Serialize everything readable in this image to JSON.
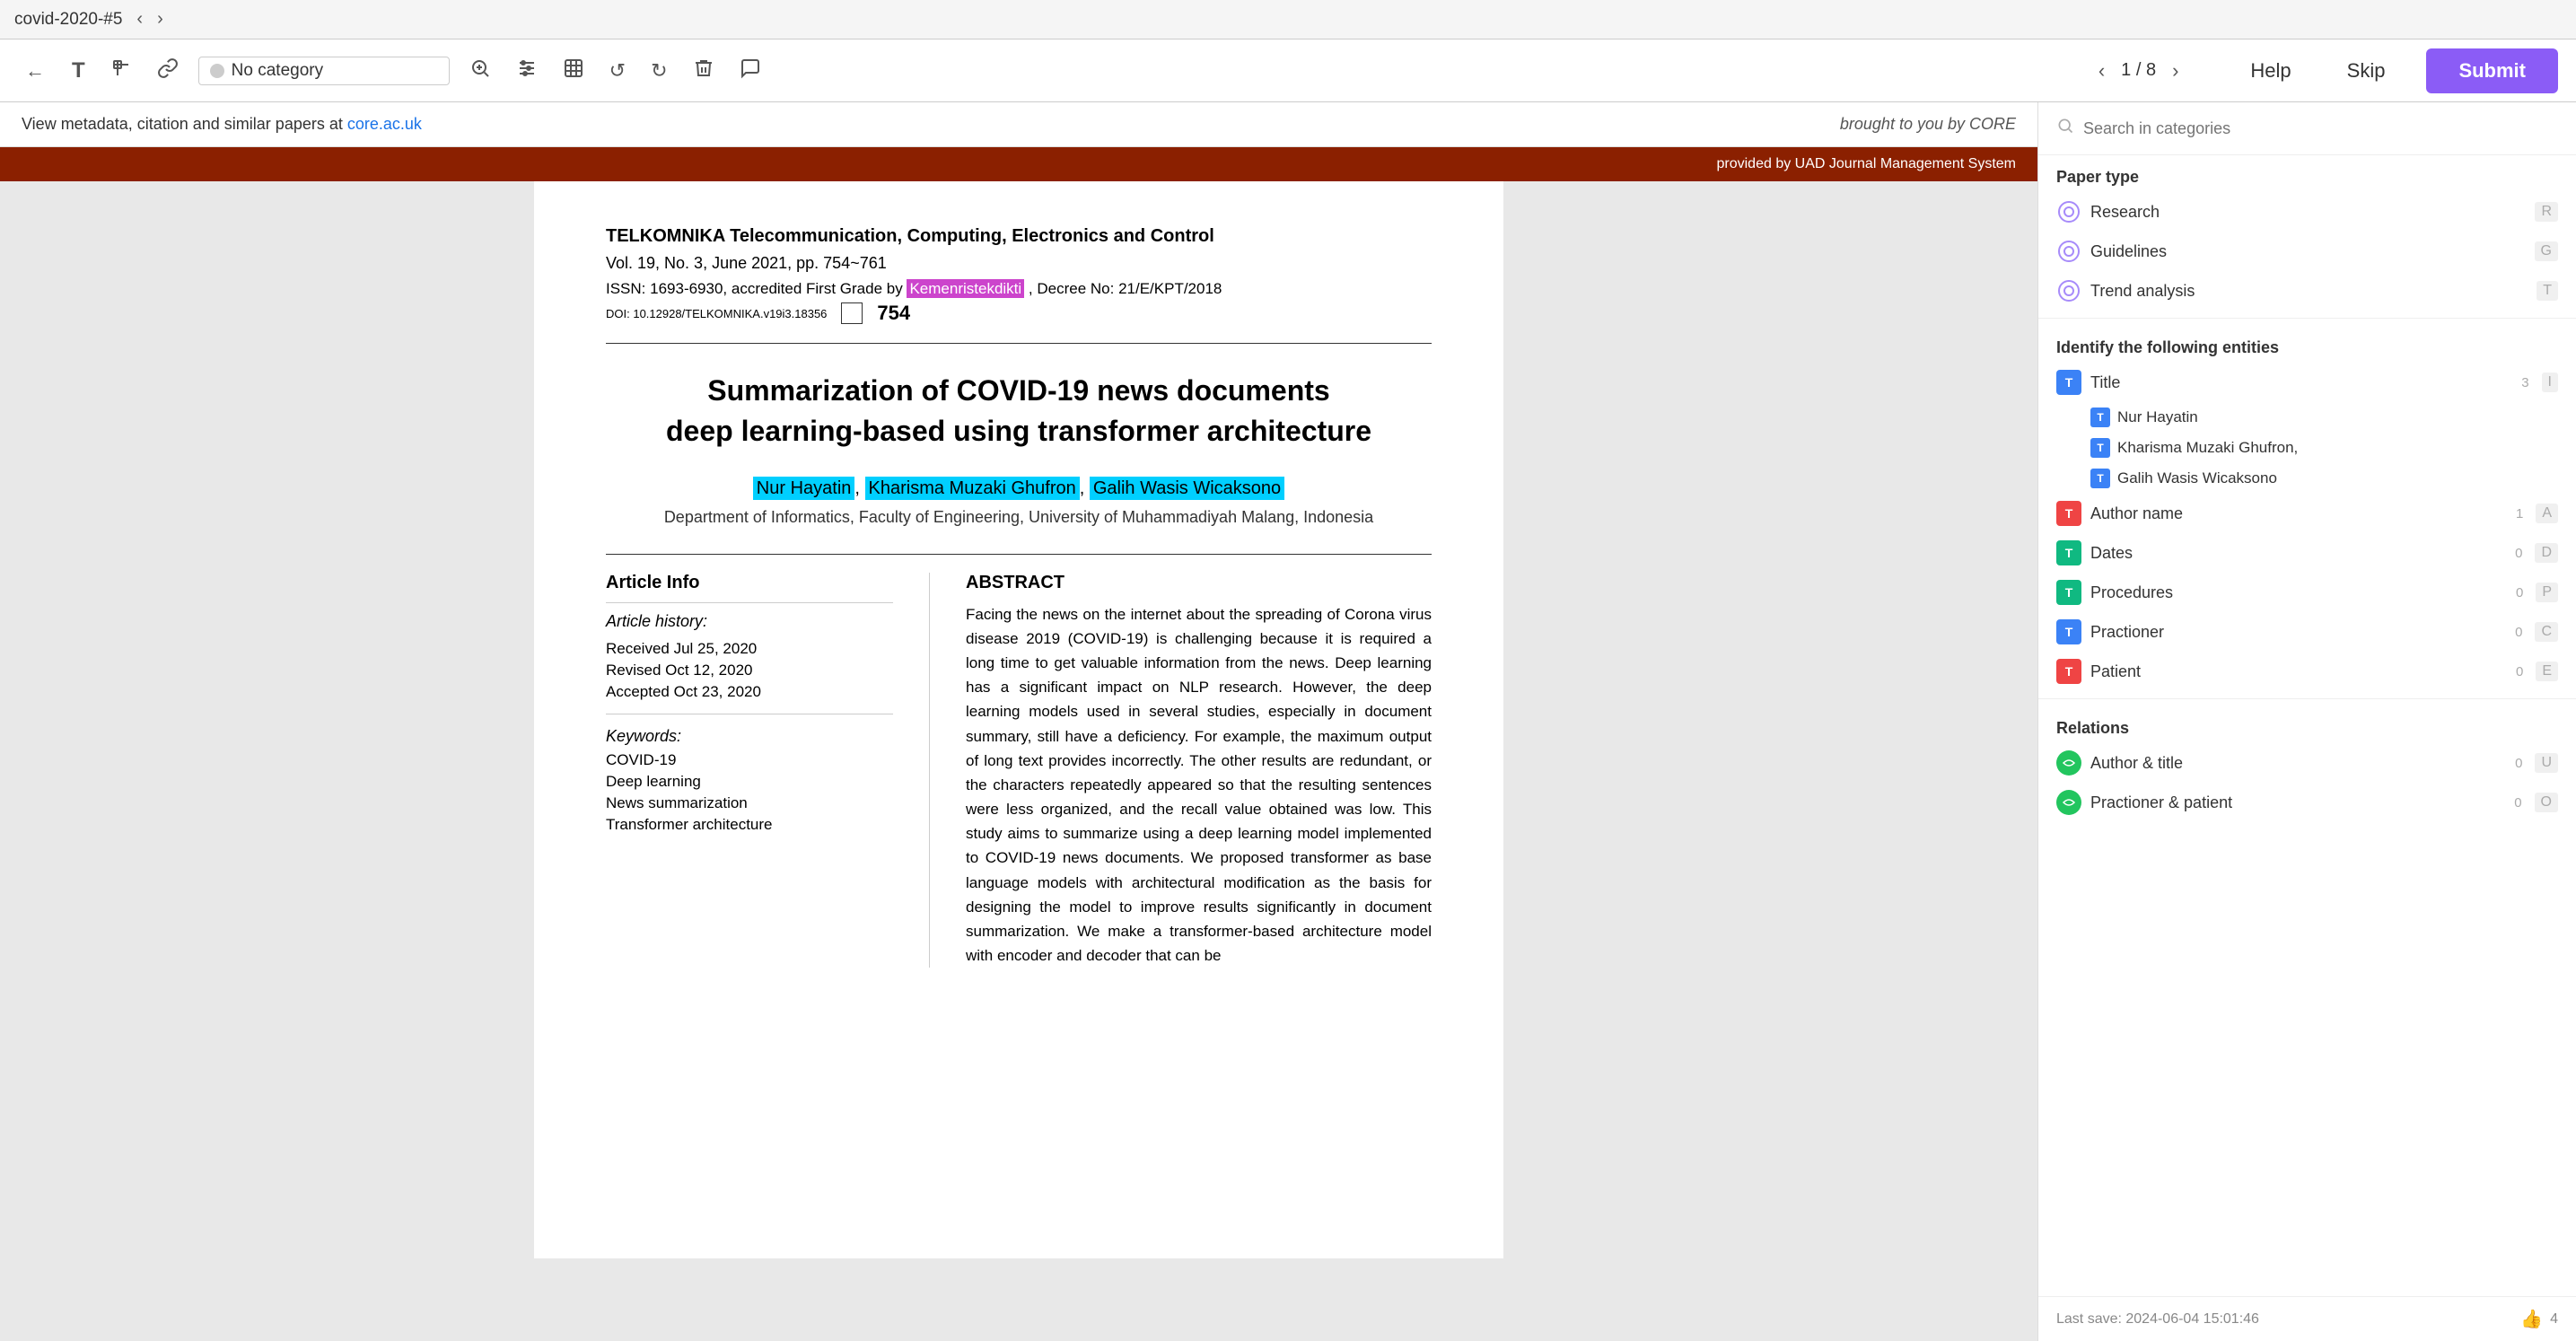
{
  "window": {
    "tab_label": "covid-2020-#5"
  },
  "topbar": {
    "back_label": "←",
    "text_tool_label": "T",
    "crop_tool_label": "✂",
    "link_tool_label": "🔗",
    "category_placeholder": "No category",
    "zoom_in_label": "🔍+",
    "adjust_label": "⚙",
    "transform_label": "⬡",
    "undo_label": "↺",
    "redo_label": "↻",
    "trash_label": "🗑",
    "comment_label": "💬",
    "prev_page_label": "‹",
    "page_current": "1",
    "page_total": "8",
    "next_page_label": "›",
    "help_label": "Help",
    "skip_label": "Skip",
    "submit_label": "Submit",
    "nav_prev": "‹",
    "nav_next": "›"
  },
  "pdf": {
    "banner_text": "View metadata, citation and similar papers at",
    "banner_link_text": "core.ac.uk",
    "core_text": "brought to you by  CORE",
    "provided_text": "provided by UAD Journal Management System",
    "journal_title": "TELKOMNIKA Telecommunication, Computing, Electronics and Control",
    "vol_info": "Vol. 19, No. 3, June 2021, pp. 754~761",
    "issn": "ISSN: 1693-6930, accredited First Grade by",
    "issn_highlight": "Kemenristekdikti",
    "issn_after": ", Decree No: 21/E/KPT/2018",
    "doi": "DOI: 10.12928/TELKOMNIKA.v19i3.18356",
    "page_num": "754",
    "paper_title_line1": "Summarization of COVID-19 news documents",
    "paper_title_line2": "deep learning-based using transformer architecture",
    "author1": "Nur Hayatin",
    "author2": "Kharisma Muzaki Ghufron",
    "author3": "Galih Wasis Wicaksono",
    "affiliation": "Department of Informatics, Faculty of Engineering, University of Muhammadiyah Malang, Indonesia",
    "article_info_title": "Article Info",
    "article_history_title": "Article history:",
    "received": "Received Jul 25, 2020",
    "revised": "Revised Oct 12, 2020",
    "accepted": "Accepted Oct 23, 2020",
    "keywords_title": "Keywords:",
    "keyword1": "COVID-19",
    "keyword2": "Deep learning",
    "keyword3": "News summarization",
    "keyword4": "Transformer architecture",
    "abstract_title": "ABSTRACT",
    "abstract_text": "Facing the news on the internet about the spreading of Corona virus disease 2019 (COVID-19) is challenging because it is required a long time to get valuable information from the news. Deep learning has a significant impact on NLP research. However, the deep learning models used in several studies, especially in document summary, still have a deficiency. For example, the maximum output of long text provides incorrectly. The other results are redundant, or the characters repeatedly appeared so that the resulting sentences were less organized, and the recall value obtained was low. This study aims to summarize using a deep learning model implemented to COVID-19 news documents. We proposed transformer as base language models with architectural modification as the basis for designing the model to improve results significantly in document summarization. We make a transformer-based architecture model with encoder and decoder that can be"
  },
  "right_panel": {
    "search_placeholder": "Search in categories",
    "paper_type_label": "Paper type",
    "categories": [
      {
        "name": "Research",
        "shortcut": "R"
      },
      {
        "name": "Guidelines",
        "shortcut": "G"
      },
      {
        "name": "Trend analysis",
        "shortcut": "T"
      }
    ],
    "entities_label": "Identify the following entities",
    "entities": [
      {
        "name": "Title",
        "count": "3",
        "shortcut": "I",
        "color": "title"
      },
      {
        "name": "Nur Hayatin",
        "color": "title",
        "tagged": true
      },
      {
        "name": "Kharisma Muzaki Ghufron,",
        "color": "title",
        "tagged": true
      },
      {
        "name": "Galih Wasis Wicaksono",
        "color": "title",
        "tagged": true
      },
      {
        "name": "Author name",
        "count": "1",
        "shortcut": "A",
        "color": "author"
      },
      {
        "name": "Dates",
        "count": "0",
        "shortcut": "D",
        "color": "dates"
      },
      {
        "name": "Procedures",
        "count": "0",
        "shortcut": "P",
        "color": "procedures"
      },
      {
        "name": "Practioner",
        "count": "0",
        "shortcut": "C",
        "color": "practioner"
      },
      {
        "name": "Patient",
        "count": "0",
        "shortcut": "E",
        "color": "patient"
      }
    ],
    "relations_label": "Relations",
    "relations": [
      {
        "name": "Author & title",
        "count": "0",
        "shortcut": "U"
      },
      {
        "name": "Practioner & patient",
        "count": "0",
        "shortcut": "O"
      }
    ],
    "last_save": "Last save: 2024-06-04 15:01:46",
    "thumb_count": "4"
  }
}
